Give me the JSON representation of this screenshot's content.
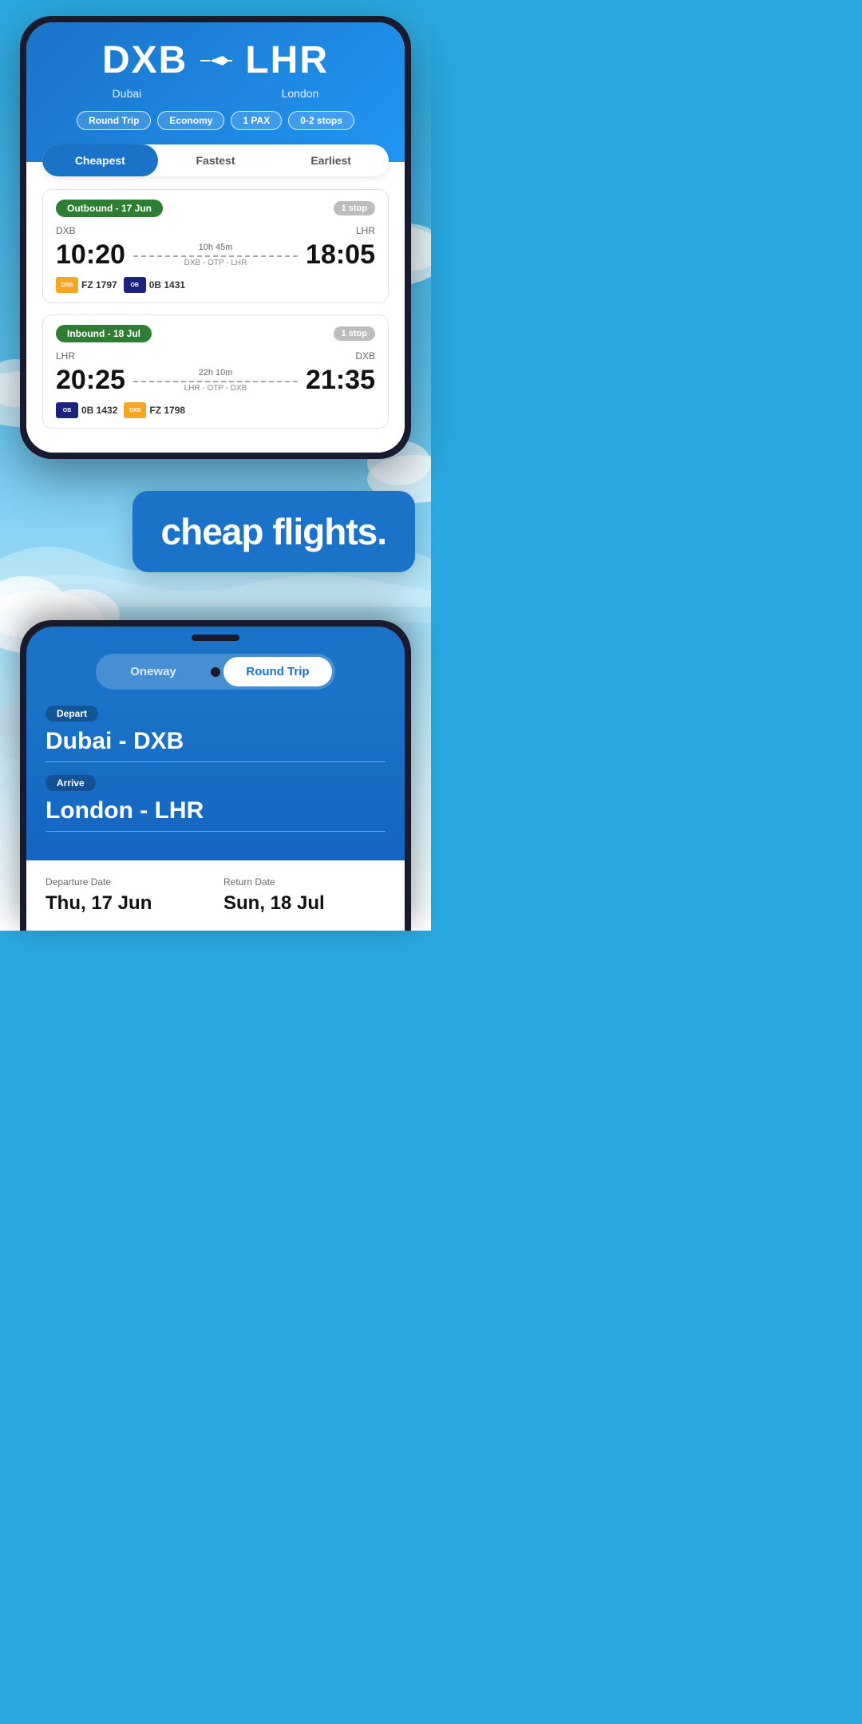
{
  "phone1": {
    "header": {
      "origin_code": "DXB",
      "origin_city": "Dubai",
      "destination_code": "LHR",
      "destination_city": "London",
      "filters": [
        "Round Trip",
        "Economy",
        "1 PAX",
        "0-2 stops"
      ]
    },
    "tabs": [
      "Cheapest",
      "Fastest",
      "Earliest"
    ],
    "active_tab": "Cheapest",
    "outbound": {
      "label": "Outbound - 17 Jun",
      "stop_label": "1 stop",
      "origin": "DXB",
      "destination": "LHR",
      "dep_time": "10:20",
      "arr_time": "18:05",
      "duration": "10h 45m",
      "via": "DXB - OTP - LHR",
      "airlines": [
        {
          "code": "FZ 1797",
          "color": "dubai"
        },
        {
          "code": "0B 1431",
          "color": "blue"
        }
      ]
    },
    "inbound": {
      "label": "Inbound - 18 Jul",
      "stop_label": "1 stop",
      "origin": "LHR",
      "destination": "DXB",
      "dep_time": "20:25",
      "arr_time": "21:35",
      "duration": "22h 10m",
      "via": "LHR - OTP - DXB",
      "airlines": [
        {
          "code": "0B 1432",
          "color": "blue"
        },
        {
          "code": "FZ 1798",
          "color": "dubai"
        }
      ]
    }
  },
  "midtext": "cheap flights.",
  "phone2": {
    "toggle": {
      "option1": "Oneway",
      "option2": "Round Trip",
      "active": "Round Trip"
    },
    "depart_label": "Depart",
    "depart_value": "Dubai - DXB",
    "arrive_label": "Arrive",
    "arrive_value": "London - LHR",
    "departure_date_label": "Departure Date",
    "departure_date_value": "Thu, 17 Jun",
    "return_date_label": "Return Date",
    "return_date_value": "Sun, 18 Jul"
  }
}
